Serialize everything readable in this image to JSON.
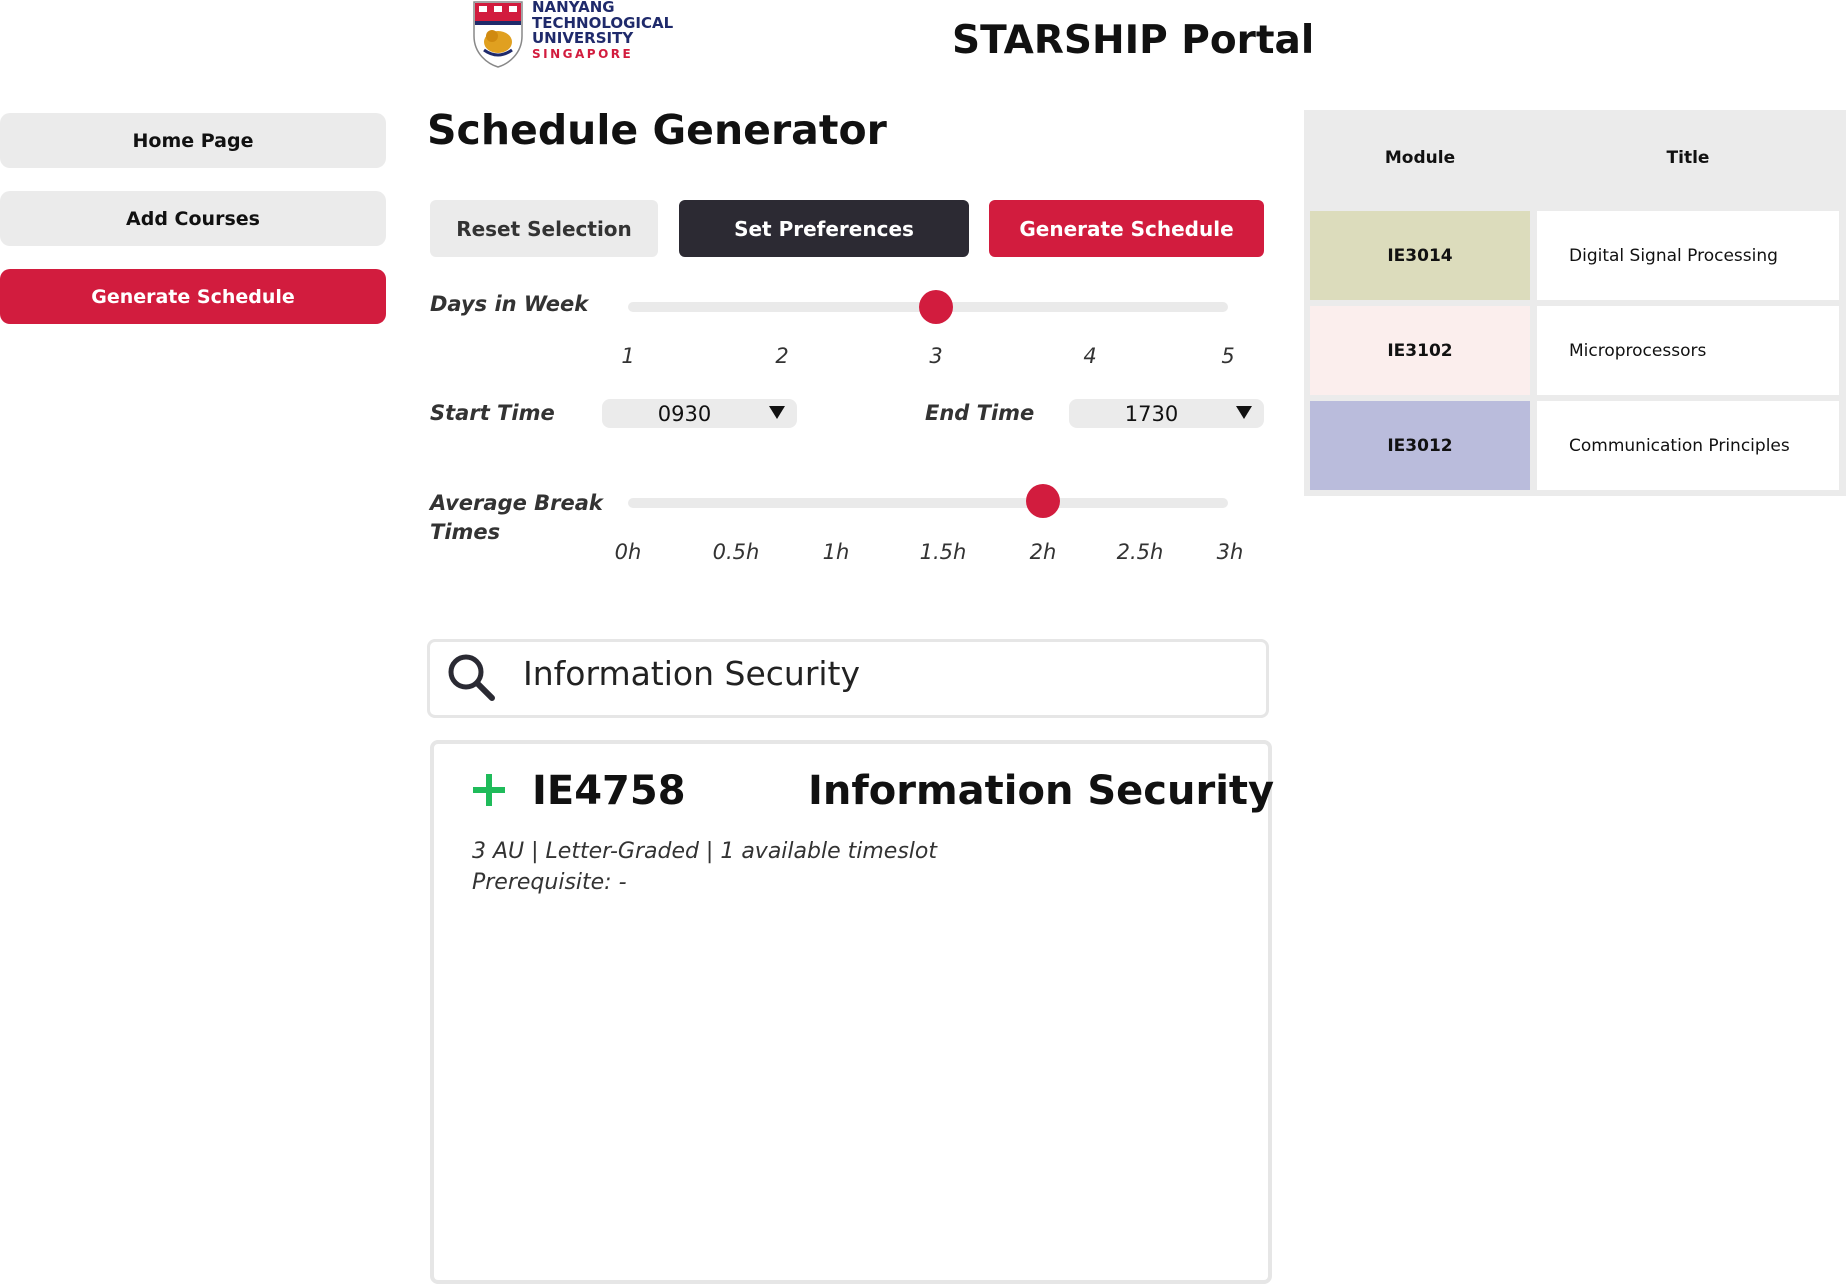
{
  "header": {
    "logo": {
      "name": "ntu-crest-icon",
      "lines": [
        "NANYANG",
        "TECHNOLOGICAL",
        "UNIVERSITY",
        "SINGAPORE"
      ]
    },
    "portal_title": "STARSHIP Portal"
  },
  "sidebar": {
    "items": [
      {
        "label": "Home Page",
        "active": false
      },
      {
        "label": "Add Courses",
        "active": false
      },
      {
        "label": "Generate Schedule",
        "active": true
      }
    ]
  },
  "main": {
    "title": "Schedule Generator",
    "actions": {
      "reset_label": "Reset Selection",
      "preferences_label": "Set Preferences",
      "generate_label": "Generate Schedule"
    },
    "days_in_week": {
      "label": "Days in Week",
      "ticks": [
        "1",
        "2",
        "3",
        "4",
        "5"
      ],
      "value": "3"
    },
    "start_time": {
      "label": "Start Time",
      "value": "0930"
    },
    "end_time": {
      "label": "End Time",
      "value": "1730"
    },
    "break_times": {
      "label_line1": "Average Break",
      "label_line2": "Times",
      "ticks": [
        "0h",
        "0.5h",
        "1h",
        "1.5h",
        "2h",
        "2.5h",
        "3h"
      ],
      "value": "2h"
    },
    "search": {
      "value": "Information Security",
      "icon": "search-icon"
    },
    "result": {
      "add_icon": "plus-icon",
      "code": "IE4758",
      "title": "Information Security",
      "meta": "3 AU | Letter-Graded | 1 available timeslot",
      "prerequisite": "Prerequisite: -"
    }
  },
  "modules_table": {
    "headers": {
      "module": "Module",
      "title": "Title"
    },
    "rows": [
      {
        "module": "IE3014",
        "title": "Digital Signal Processing",
        "color": "#dcdcbc"
      },
      {
        "module": "IE3102",
        "title": "Microprocessors",
        "color": "#fbeeed"
      },
      {
        "module": "IE3012",
        "title": "Communication Principles",
        "color": "#babcdc"
      }
    ]
  },
  "colors": {
    "accent": "#d21c3e",
    "dark_button": "#2c2a33",
    "add_green": "#1fbb5a"
  }
}
